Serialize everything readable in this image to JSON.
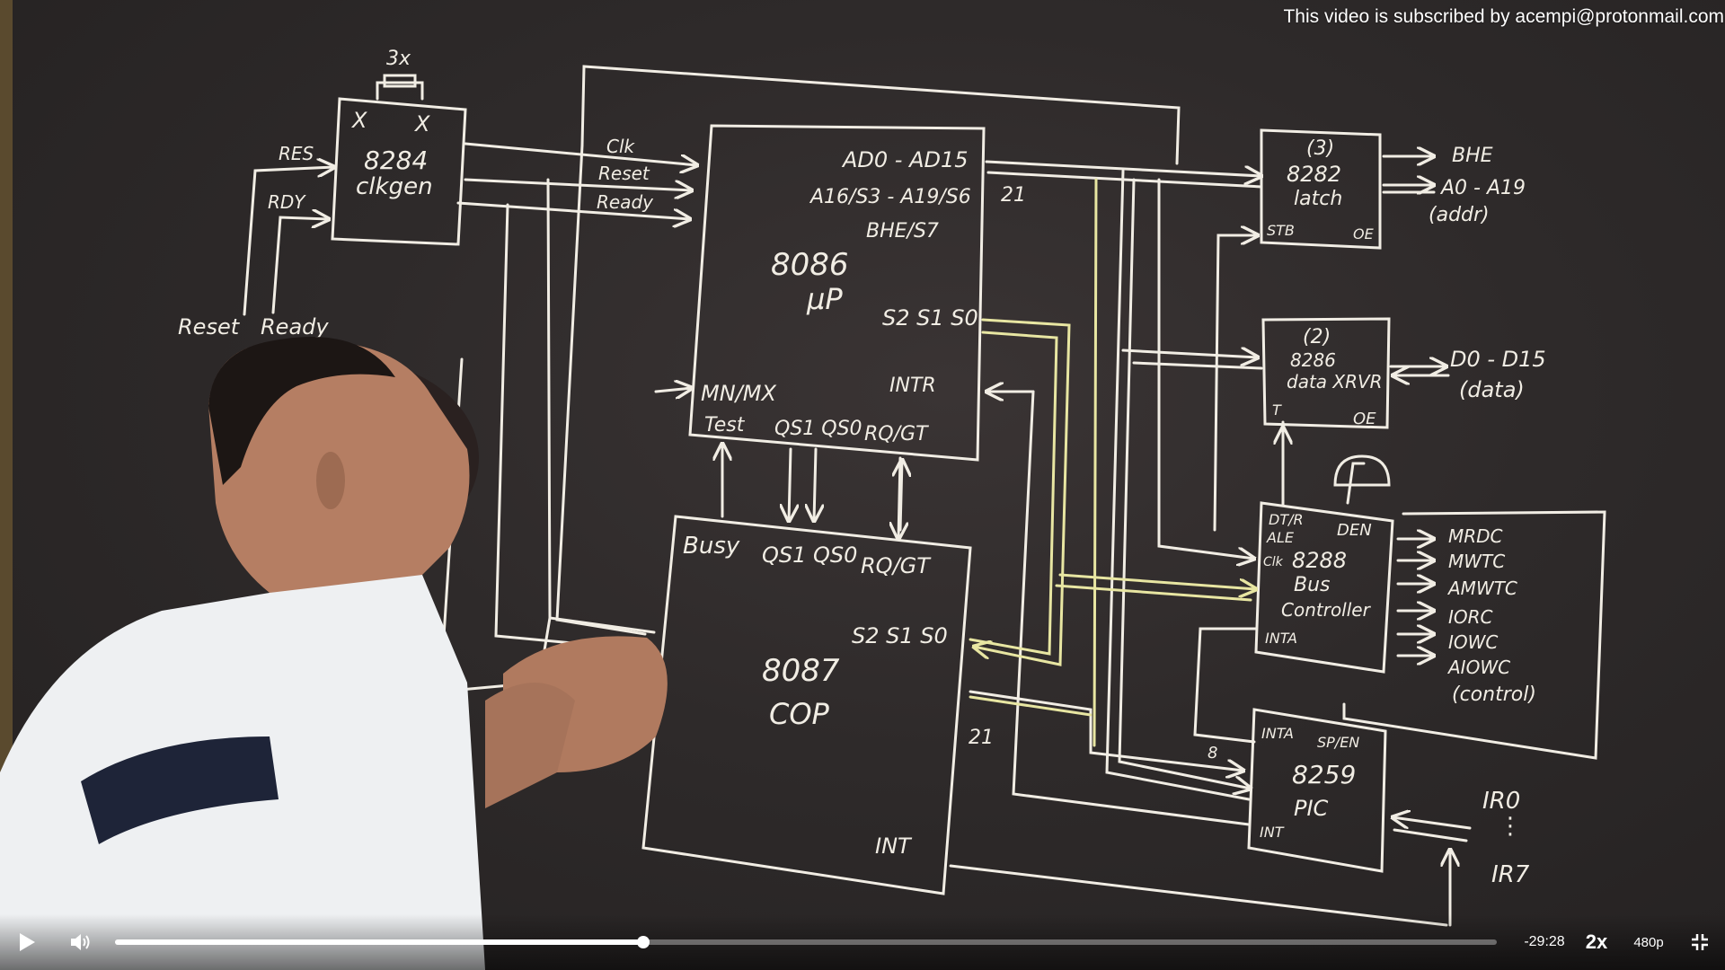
{
  "watermark": "This video is subscribed by acempi@protonmail.com",
  "player": {
    "play_icon": "play-icon",
    "volume_icon": "volume-icon",
    "progress_fraction": 0.382,
    "time_remaining": "-29:28",
    "speed": "2x",
    "quality": "480p",
    "fullscreen_icon": "exit-fullscreen-icon"
  },
  "board": {
    "crystal": "3x",
    "clk_x1": "X",
    "clk_x2": "X",
    "clkgen_num": "8284",
    "clkgen_name": "clkgen",
    "res": "RES",
    "rdy": "RDY",
    "reset_in": "Reset",
    "ready_in": "Ready",
    "clk": "Clk",
    "reset": "Reset",
    "ready": "Ready",
    "cpu_ad": "AD0 - AD15",
    "cpu_a16": "A16/S3 - A19/S6",
    "cpu_bhe": "BHE/S7",
    "cpu_num": "8086",
    "cpu_up": "µP",
    "cpu_s": "S2 S1 S0",
    "cpu_intr": "INTR",
    "cpu_mn": "MN/MX",
    "cpu_test": "Test",
    "cpu_qs": "QS1 QS0",
    "cpu_rq": "RQ/GT",
    "bus21": "21",
    "cop_busy": "Busy",
    "cop_qs": "QS1 QS0",
    "cop_rq": "RQ/GT",
    "cop_s": "S2 S1 S0",
    "cop_num": "8087",
    "cop_name": "COP",
    "cop_int": "INT",
    "cop21": "21",
    "latch_count": "(3)",
    "latch_num": "8282",
    "latch_name": "latch",
    "latch_stb": "STB",
    "latch_oe": "OE",
    "bhe_out": "BHE",
    "addr_out": "A0 - A19",
    "addr_label": "(addr)",
    "xcvr_count": "(2)",
    "xcvr_num": "8286",
    "xcvr_name": "data XRVR",
    "xcvr_t": "T",
    "xcvr_oe": "OE",
    "data_out": "D0 - D15",
    "data_label": "(data)",
    "bc_dtr": "DT/R",
    "bc_den": "DEN",
    "bc_ale": "ALE",
    "bc_clk": "Clk",
    "bc_num": "8288",
    "bc_bus": "Bus",
    "bc_ctrl": "Controller",
    "bc_inta": "INTA",
    "ctrl_mrdc": "MRDC",
    "ctrl_mwtc": "MWTC",
    "ctrl_amwtc": "AMWTC",
    "ctrl_iorc": "IORC",
    "ctrl_iowc": "IOWC",
    "ctrl_aiowc": "AIOWC",
    "ctrl_label": "(control)",
    "pic_inta": "INTA",
    "pic_sp": "SP/EN",
    "pic_num": "8259",
    "pic_name": "PIC",
    "pic_int": "INT",
    "pic8": "8",
    "ir0": "IR0",
    "ir7": "IR7"
  }
}
